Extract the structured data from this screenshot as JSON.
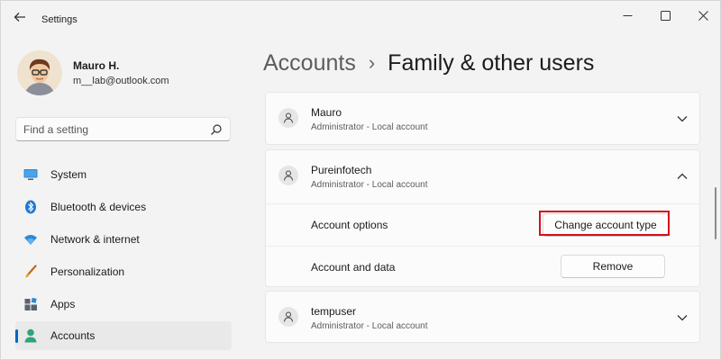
{
  "window": {
    "title": "Settings",
    "back_icon": "arrow-left-icon",
    "controls": [
      "minimize-icon",
      "maximize-icon",
      "close-icon"
    ]
  },
  "profile": {
    "name": "Mauro H.",
    "email": "m__lab@outlook.com"
  },
  "search": {
    "placeholder": "Find a setting",
    "icon": "search-icon"
  },
  "sidebar": {
    "items": [
      {
        "label": "System",
        "icon": "monitor-icon"
      },
      {
        "label": "Bluetooth & devices",
        "icon": "bluetooth-icon"
      },
      {
        "label": "Network & internet",
        "icon": "wifi-icon"
      },
      {
        "label": "Personalization",
        "icon": "brush-icon"
      },
      {
        "label": "Apps",
        "icon": "apps-icon"
      },
      {
        "label": "Accounts",
        "icon": "person-icon",
        "active": true
      }
    ]
  },
  "header": {
    "parent": "Accounts",
    "separator": "›",
    "current": "Family & other users"
  },
  "users": [
    {
      "name": "Mauro",
      "role": "Administrator - Local account",
      "expanded": false
    },
    {
      "name": "Pureinfotech",
      "role": "Administrator - Local account",
      "expanded": true,
      "options": {
        "account_options_label": "Account options",
        "change_type_label": "Change account type",
        "account_data_label": "Account and data",
        "remove_label": "Remove"
      }
    },
    {
      "name": "tempuser",
      "role": "Administrator - Local account",
      "expanded": false
    }
  ],
  "colors": {
    "accent": "#0067c0",
    "highlight": "#d0121b",
    "background": "#f3f3f3",
    "card": "#fbfbfb"
  }
}
